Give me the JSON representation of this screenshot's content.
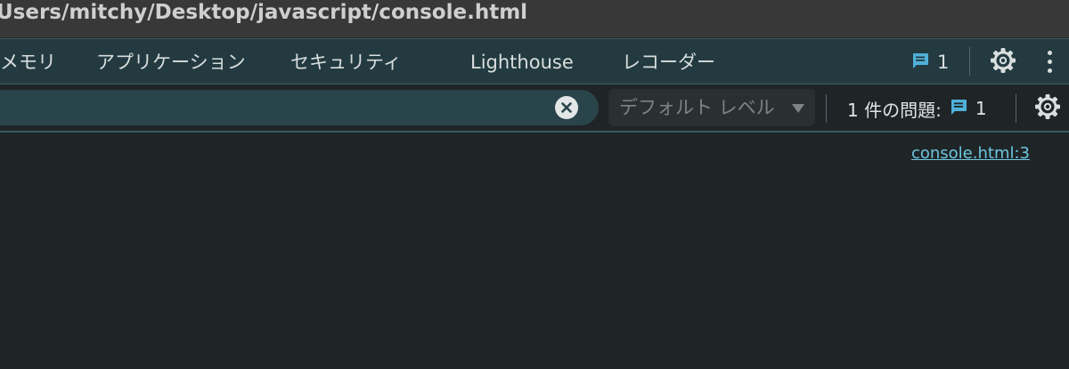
{
  "window": {
    "title": "Users/mitchy/Desktop/javascript/console.html"
  },
  "tabs": [
    {
      "label": "メモリ"
    },
    {
      "label": "アプリケーション"
    },
    {
      "label": "セキュリティ"
    },
    {
      "label": "Lighthouse"
    },
    {
      "label": "レコーダー"
    }
  ],
  "toolbar": {
    "issues_count": "1",
    "issues_icon": "message-icon",
    "settings_icon": "gear-icon",
    "more_icon": "kebab-menu-icon"
  },
  "filter": {
    "value": "",
    "clear_icon": "close-circle-icon",
    "level_label": "デフォルト レベル",
    "issues_text": "1 件の問題:",
    "issues_count": "1"
  },
  "console": {
    "source_link": "console.html:3"
  },
  "colors": {
    "tabbar_bg": "#233b40",
    "filter_bg": "#29444a",
    "console_bg": "#1f2427",
    "link": "#6cc7e0",
    "issue_icon": "#4fb0d8"
  }
}
